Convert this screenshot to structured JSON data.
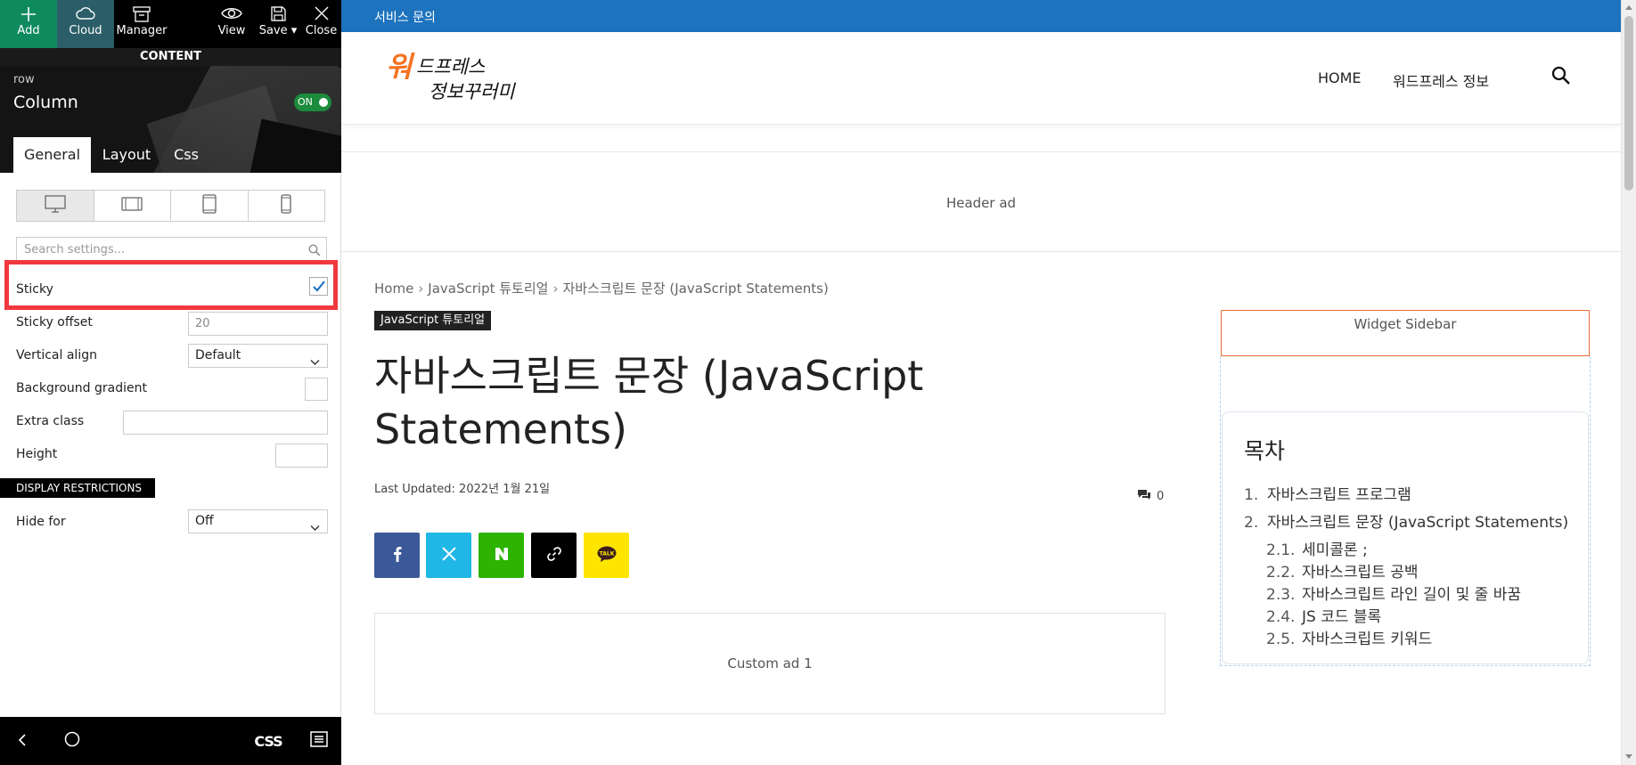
{
  "toolbar": {
    "add_label": "Add",
    "cloud_label": "Cloud",
    "manager_label": "Manager",
    "view_label": "View",
    "save_label": "Save ▾",
    "close_label": "Close"
  },
  "panel": {
    "section_title": "CONTENT",
    "element_type": "row",
    "element_title": "Column",
    "toggle_label": "ON",
    "tabs": [
      "General",
      "Layout",
      "Css"
    ],
    "search_placeholder": "Search settings...",
    "settings": {
      "sticky_label": "Sticky",
      "sticky_checked": true,
      "sticky_offset_label": "Sticky offset",
      "sticky_offset_placeholder": "20",
      "vertical_align_label": "Vertical align",
      "vertical_align_value": "Default",
      "background_gradient_label": "Background gradient",
      "extra_class_label": "Extra class",
      "height_label": "Height"
    },
    "display_restrictions_title": "DISPLAY RESTRICTIONS",
    "hide_for_label": "Hide for",
    "hide_for_value": "Off",
    "bottom_css_label": "CSS"
  },
  "site": {
    "topbar_link": "서비스 문의",
    "logo_alt": "워드프레스 정보꾸러미",
    "nav": [
      "HOME",
      "워드프레스 정보"
    ],
    "header_ad": "Header ad",
    "breadcrumb": [
      "Home",
      "JavaScript 튜토리얼",
      "자바스크립트 문장 (JavaScript Statements)"
    ],
    "category": "JavaScript 튜토리얼",
    "post_title": "자바스크립트 문장 (JavaScript Statements)",
    "last_updated": "Last Updated: 2022년 1월 21일",
    "comment_count": "0",
    "share_buttons": [
      "facebook",
      "x",
      "naver",
      "copy-link",
      "kakaotalk"
    ],
    "custom_ad": "Custom ad 1",
    "widget_sidebar": "Widget Sidebar",
    "toc": {
      "title": "목차",
      "items": [
        {
          "num": "1.",
          "text": "자바스크립트 프로그램"
        },
        {
          "num": "2.",
          "text": "자바스크립트 문장 (JavaScript Statements)"
        }
      ],
      "subitems": [
        {
          "num": "2.1.",
          "text": "세미콜론 ;"
        },
        {
          "num": "2.2.",
          "text": "자바스크립트 공백"
        },
        {
          "num": "2.3.",
          "text": "자바스크립트 라인 길이 및 줄 바꿈"
        },
        {
          "num": "2.4.",
          "text": "JS 코드 블록"
        },
        {
          "num": "2.5.",
          "text": "자바스크립트 키워드"
        }
      ]
    }
  },
  "colors": {
    "topbar_blue": "#1e73be",
    "add_green": "#0f8a5f",
    "highlight_red": "#f0393f",
    "widget_orange": "#e96b3b"
  }
}
